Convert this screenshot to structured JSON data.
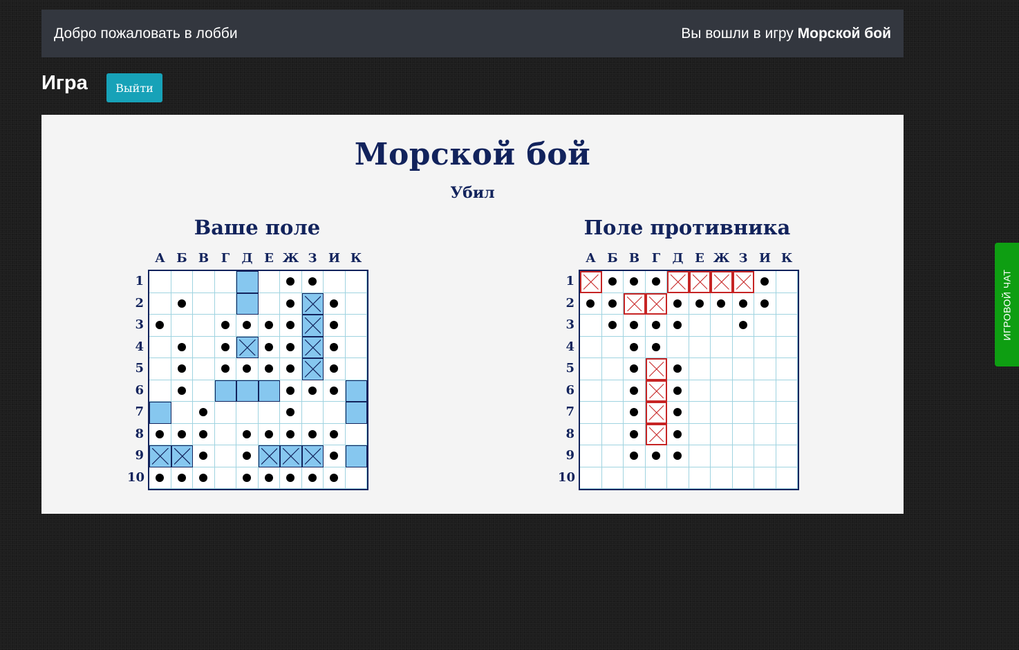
{
  "topbar": {
    "welcome": "Добро пожаловать в лобби",
    "joined_prefix": "Вы вошли в игру",
    "game_name": "Морской бой"
  },
  "game": {
    "title": "Игра",
    "exit_label": "Выйти"
  },
  "board": {
    "title": "Морской бой",
    "status": "Убил",
    "columns": [
      "А",
      "Б",
      "В",
      "Г",
      "Д",
      "Е",
      "Ж",
      "З",
      "И",
      "К"
    ],
    "rows": [
      "1",
      "2",
      "3",
      "4",
      "5",
      "6",
      "7",
      "8",
      "9",
      "10"
    ],
    "legend": {
      ".": "empty",
      "o": "miss",
      "S": "ship",
      "X": "hit ship",
      "R": "hit enemy ship"
    },
    "my_field": {
      "title": "Ваше поле",
      "cells": [
        "....S.oo..",
        ".o..S.oXo.",
        "o..ooooXo.",
        ".o.oXooXo.",
        ".o.ooooXo.",
        ".o.SSSooos",
        "S.o...o..S",
        "ooo.ooooo.",
        "XXo.oXXXoS",
        "ooo.ooooo."
      ]
    },
    "enemy_field": {
      "title": "Поле противника",
      "cells": [
        "RoooRRRRo.",
        "ooRRooooo.",
        ".oooo..o..",
        "..oo......",
        "..oRo.....",
        "..oRo.....",
        "..oRo.....",
        "..oRo.....",
        "..ooo.....",
        ".........."
      ]
    }
  },
  "chat": {
    "label": "ИГРОВОЙ ЧАТ"
  }
}
